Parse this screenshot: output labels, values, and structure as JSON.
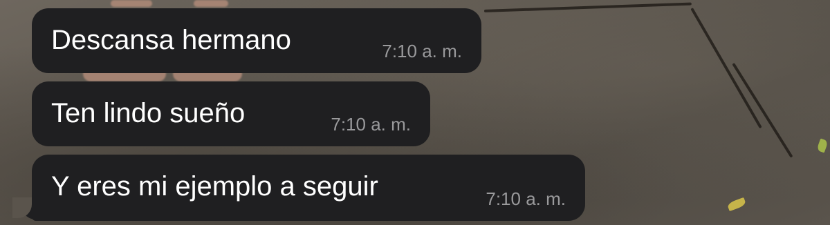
{
  "messages": [
    {
      "text": "Descansa hermano",
      "time": "7:10 a. m."
    },
    {
      "text": "Ten lindo sueño",
      "time": "7:10 a. m."
    },
    {
      "text": "Y eres mi ejemplo a seguir",
      "time": "7:10 a. m."
    }
  ],
  "colors": {
    "bubble": "#1f1f21",
    "text": "#ffffff",
    "timestamp": "#9a9a9c"
  }
}
